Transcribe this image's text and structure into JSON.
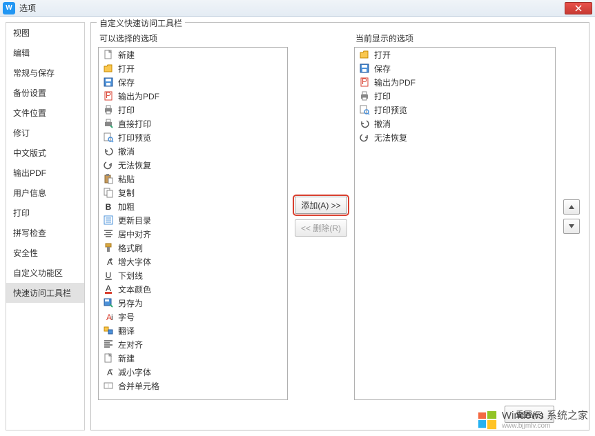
{
  "window": {
    "title": "选项",
    "app_icon_letter": "W"
  },
  "sidebar": {
    "items": [
      {
        "label": "视图"
      },
      {
        "label": "编辑"
      },
      {
        "label": "常规与保存"
      },
      {
        "label": "备份设置"
      },
      {
        "label": "文件位置"
      },
      {
        "label": "修订"
      },
      {
        "label": "中文版式"
      },
      {
        "label": "输出PDF"
      },
      {
        "label": "用户信息"
      },
      {
        "label": "打印"
      },
      {
        "label": "拼写检查"
      },
      {
        "label": "安全性"
      },
      {
        "label": "自定义功能区"
      },
      {
        "label": "快速访问工具栏"
      }
    ],
    "selected_index": 13
  },
  "main": {
    "fieldset_title": "自定义快速访问工具栏",
    "left_label": "可以选择的选项",
    "right_label": "当前显示的选项",
    "available": [
      {
        "icon": "new",
        "label": "新建"
      },
      {
        "icon": "open",
        "label": "打开"
      },
      {
        "icon": "save",
        "label": "保存"
      },
      {
        "icon": "pdf",
        "label": "输出为PDF"
      },
      {
        "icon": "print",
        "label": "打印"
      },
      {
        "icon": "print-direct",
        "label": "直接打印"
      },
      {
        "icon": "print-preview",
        "label": "打印预览"
      },
      {
        "icon": "undo",
        "label": "撤消"
      },
      {
        "icon": "redo",
        "label": "无法恢复"
      },
      {
        "icon": "paste",
        "label": "粘贴"
      },
      {
        "icon": "copy",
        "label": "复制"
      },
      {
        "icon": "bold",
        "label": "加粗"
      },
      {
        "icon": "toc",
        "label": "更新目录"
      },
      {
        "icon": "center",
        "label": "居中对齐"
      },
      {
        "icon": "format-painter",
        "label": "格式刷"
      },
      {
        "icon": "font-inc",
        "label": "增大字体"
      },
      {
        "icon": "underline",
        "label": "下划线"
      },
      {
        "icon": "font-color",
        "label": "文本颜色"
      },
      {
        "icon": "save-as",
        "label": "另存为"
      },
      {
        "icon": "font-size",
        "label": "字号"
      },
      {
        "icon": "translate",
        "label": "翻译"
      },
      {
        "icon": "align-left",
        "label": "左对齐"
      },
      {
        "icon": "new2",
        "label": "新建"
      },
      {
        "icon": "font-dec",
        "label": "减小字体"
      },
      {
        "icon": "merge",
        "label": "合并单元格"
      }
    ],
    "current": [
      {
        "icon": "open",
        "label": "打开"
      },
      {
        "icon": "save",
        "label": "保存"
      },
      {
        "icon": "pdf",
        "label": "输出为PDF"
      },
      {
        "icon": "print",
        "label": "打印"
      },
      {
        "icon": "print-preview",
        "label": "打印预览"
      },
      {
        "icon": "undo",
        "label": "撤消"
      },
      {
        "icon": "redo",
        "label": "无法恢复"
      }
    ],
    "buttons": {
      "add": "添加(A) >>",
      "remove": "<< 删除(R)",
      "reset": "重置(E)"
    }
  },
  "watermark": {
    "brand": "Windows 系统之家",
    "domain": "www.bjjmlv.com"
  }
}
